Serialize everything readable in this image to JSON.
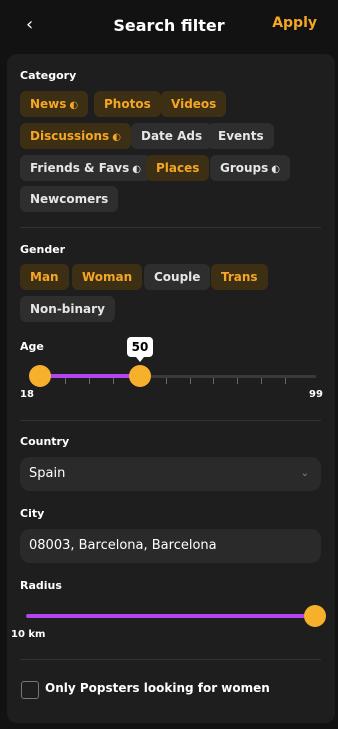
{
  "header": {
    "back_icon": "‹",
    "title": "Search filter",
    "apply_label": "Apply"
  },
  "category": {
    "label": "Category",
    "chips": [
      {
        "label": "News",
        "icon": "◐",
        "selected": true
      },
      {
        "label": "Photos",
        "icon": "",
        "selected": true
      },
      {
        "label": "Videos",
        "icon": "",
        "selected": true
      },
      {
        "label": "Discussions",
        "icon": "◐",
        "selected": true
      },
      {
        "label": "Date Ads",
        "icon": "",
        "selected": false
      },
      {
        "label": "Events",
        "icon": "",
        "selected": false
      },
      {
        "label": "Friends & Favs",
        "icon": "◐",
        "selected": false
      },
      {
        "label": "Places",
        "icon": "",
        "selected": true
      },
      {
        "label": "Groups",
        "icon": "◐",
        "selected": false
      },
      {
        "label": "Newcomers",
        "icon": "",
        "selected": false
      }
    ]
  },
  "gender": {
    "label": "Gender",
    "chips": [
      {
        "label": "Man",
        "selected": true
      },
      {
        "label": "Woman",
        "selected": true
      },
      {
        "label": "Couple",
        "selected": false
      },
      {
        "label": "Trans",
        "selected": true
      },
      {
        "label": "Non-binary",
        "selected": false
      }
    ]
  },
  "age": {
    "label": "Age",
    "min": "18",
    "max": "99",
    "lower": 18,
    "upper": 50,
    "upper_label": "50"
  },
  "country": {
    "label": "Country",
    "value": "Spain"
  },
  "city": {
    "label": "City",
    "value": "08003, Barcelona, Barcelona"
  },
  "radius": {
    "label": "Radius",
    "min_label": "10 km",
    "fraction": 1.0
  },
  "checkbox": {
    "label": "Only Popsters looking for women",
    "checked": false
  },
  "colors": {
    "accent": "#f5a623",
    "slider": "#b245f0",
    "thumb": "#f7b02c"
  }
}
